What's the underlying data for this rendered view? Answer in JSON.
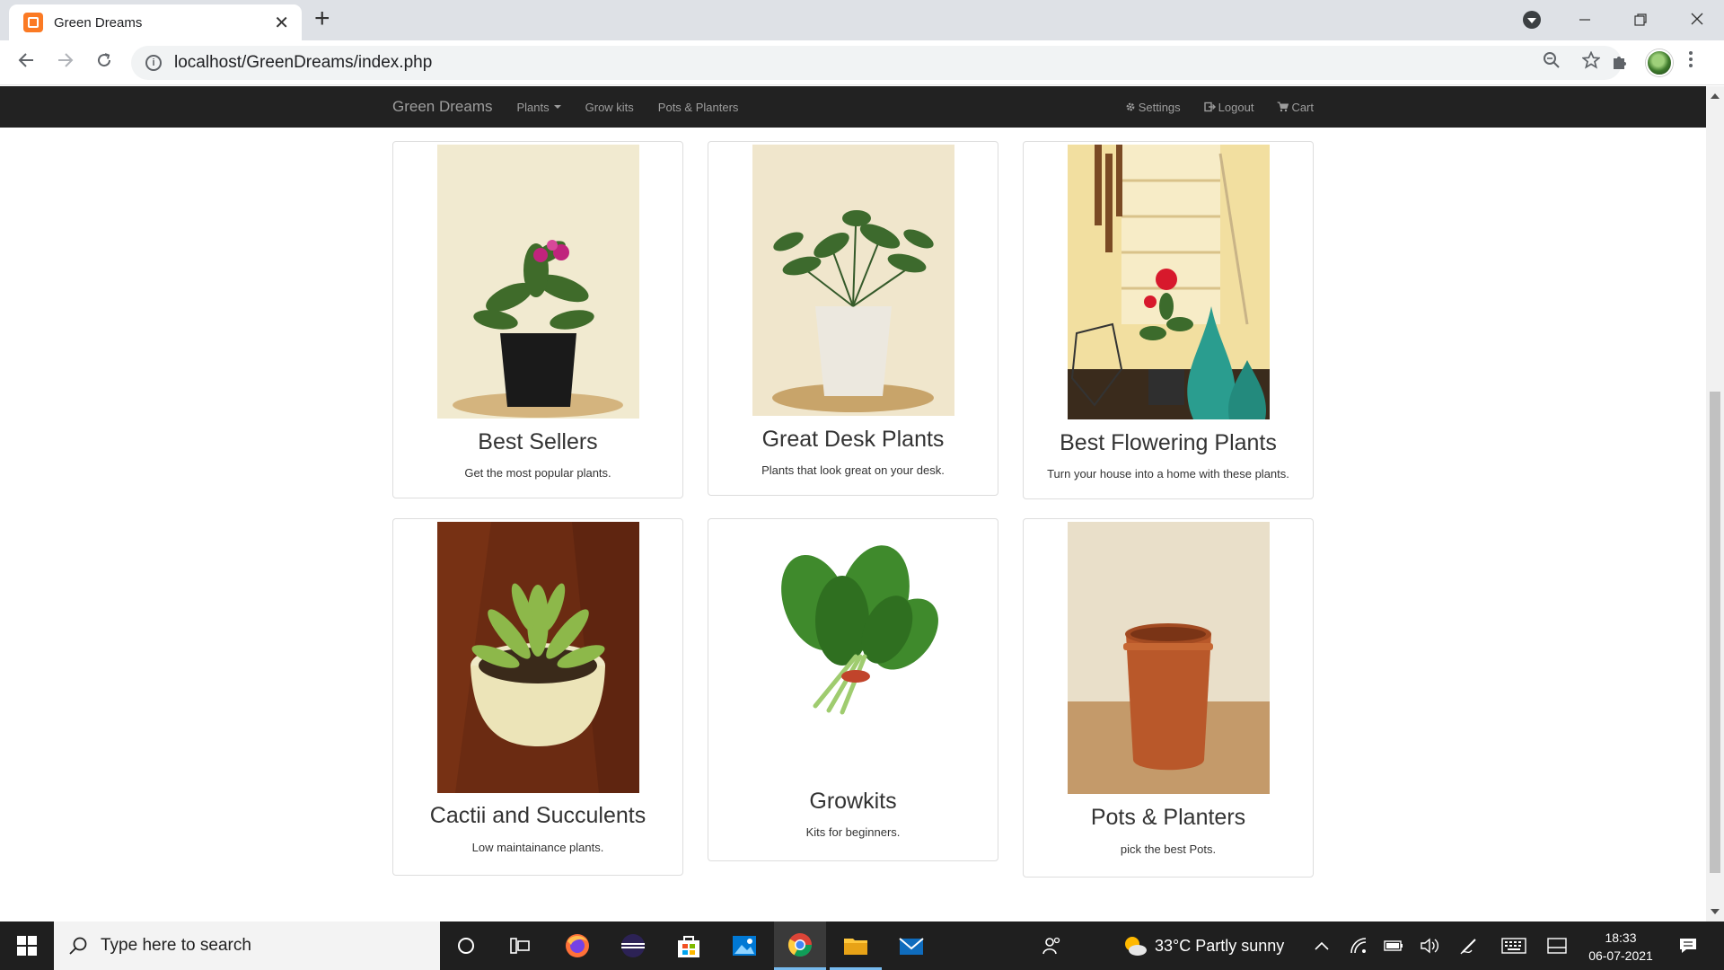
{
  "browser": {
    "tab_title": "Green Dreams",
    "tab_close": "✕",
    "new_tab": "+",
    "url": "localhost/GreenDreams/index.php"
  },
  "navbar": {
    "brand": "Green Dreams",
    "links": {
      "plants": "Plants",
      "growkits": "Grow kits",
      "pots": "Pots & Planters"
    },
    "right": {
      "settings": "Settings",
      "logout": "Logout",
      "cart": "Cart"
    }
  },
  "cards": [
    {
      "title": "Best Sellers",
      "text": "Get the most popular plants."
    },
    {
      "title": "Great Desk Plants",
      "text": "Plants that look great on your desk."
    },
    {
      "title": "Best Flowering Plants",
      "text": "Turn your house into a home with these plants."
    },
    {
      "title": "Cactii and Succulents",
      "text": "Low maintainance plants."
    },
    {
      "title": "Growkits",
      "text": "Kits for beginners."
    },
    {
      "title": "Pots & Planters",
      "text": "pick the best Pots."
    }
  ],
  "taskbar": {
    "search_placeholder": "Type here to search",
    "weather": "33°C  Partly sunny",
    "time": "18:33",
    "date": "06-07-2021"
  }
}
